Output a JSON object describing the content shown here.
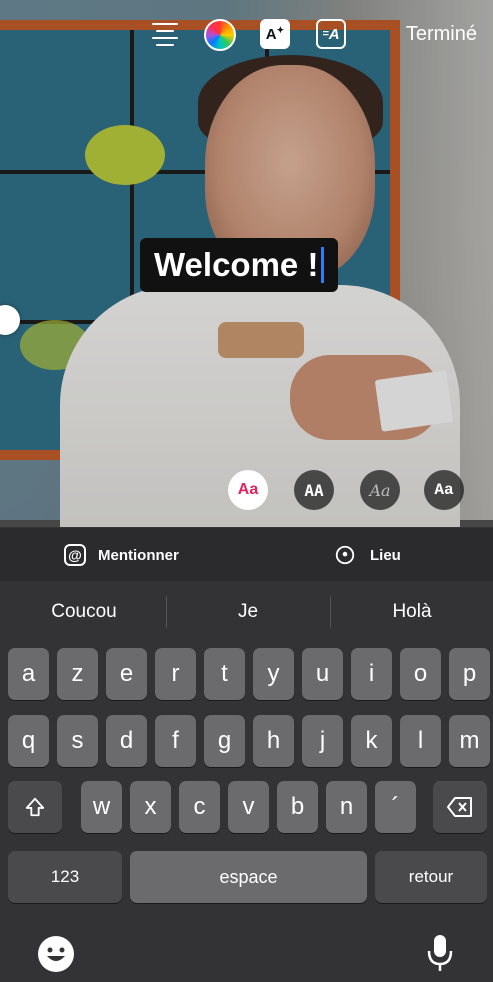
{
  "toolbar": {
    "align_icon": "align-center-icon",
    "color_icon": "color-wheel-icon",
    "effect_label": "A",
    "anim_label": "A",
    "done_label": "Terminé"
  },
  "sticker": {
    "text": "Welcome !"
  },
  "font_styles": [
    {
      "label": "Aa",
      "selected": true
    },
    {
      "label": "AA",
      "selected": false
    },
    {
      "label": "Aa",
      "selected": false
    },
    {
      "label": "Aa",
      "selected": false
    }
  ],
  "mention_bar": {
    "mention_label": "Mentionner",
    "location_label": "Lieu"
  },
  "keyboard": {
    "suggestions": [
      "Coucou",
      "Je",
      "Holà"
    ],
    "row1": [
      "a",
      "z",
      "e",
      "r",
      "t",
      "y",
      "u",
      "i",
      "o",
      "p"
    ],
    "row2": [
      "q",
      "s",
      "d",
      "f",
      "g",
      "h",
      "j",
      "k",
      "l",
      "m"
    ],
    "row3": [
      "w",
      "x",
      "c",
      "v",
      "b",
      "n",
      "´"
    ],
    "numbers_label": "123",
    "space_label": "espace",
    "return_label": "retour"
  },
  "colors": {
    "selected_font_accent": "#e0245e",
    "caret": "#2f7df6"
  }
}
